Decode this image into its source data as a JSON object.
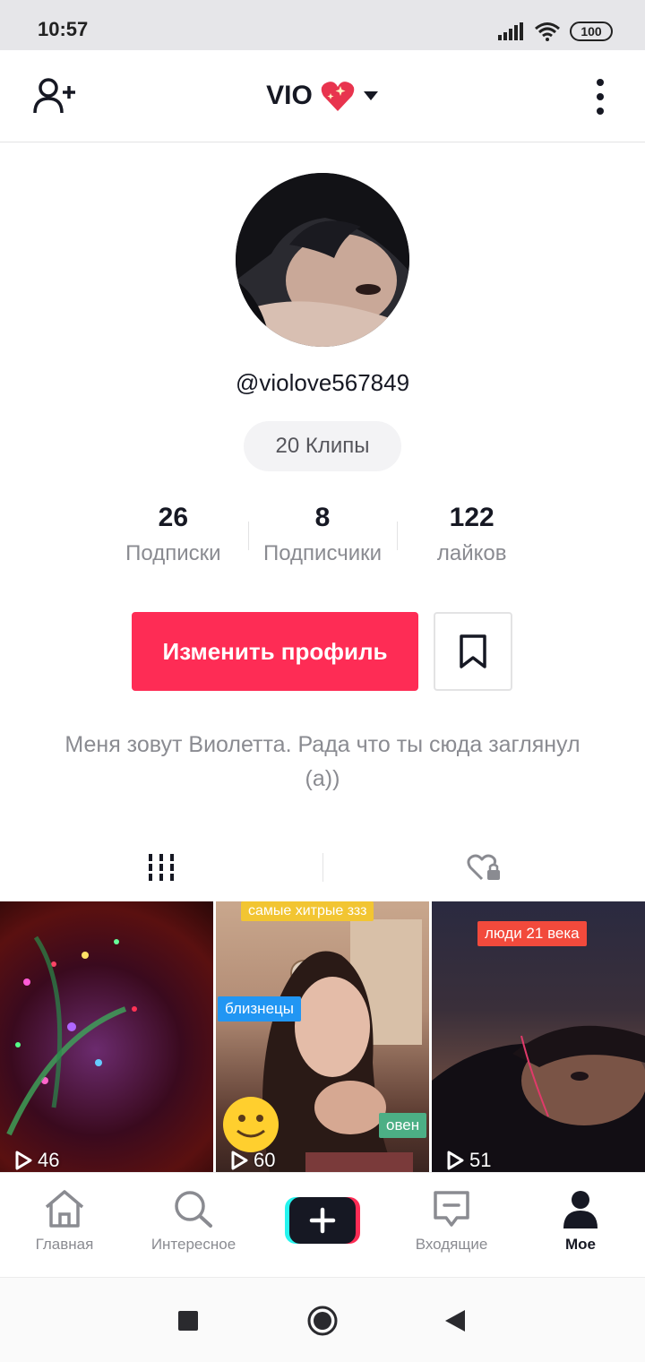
{
  "status_bar": {
    "time": "10:57",
    "battery": "100",
    "icons": [
      "signal-icon",
      "wifi-icon",
      "battery-icon"
    ]
  },
  "header": {
    "title": "VIO",
    "title_emoji": "💖",
    "left_icon": "add-friend-icon",
    "right_icon": "more-icon"
  },
  "profile": {
    "username": "@violove567849",
    "clips_label": "20 Клипы",
    "stats": [
      {
        "value": "26",
        "label": "Подписки"
      },
      {
        "value": "8",
        "label": "Подписчики"
      },
      {
        "value": "122",
        "label": "лайков"
      }
    ],
    "edit_button": "Изменить профиль",
    "bio": "Меня зовут Виолетта. Рада что ты сюда заглянул (а))"
  },
  "tabs": [
    {
      "icon": "grid-icon",
      "active": true
    },
    {
      "icon": "liked-private-icon",
      "active": false
    }
  ],
  "videos": [
    {
      "views": "46",
      "stickers": []
    },
    {
      "views": "60",
      "stickers": [
        "самые хитрые ззз",
        "близнецы",
        "овен"
      ]
    },
    {
      "views": "51",
      "stickers": [
        "люди 21 века"
      ]
    }
  ],
  "bottom_nav": [
    {
      "label": "Главная",
      "icon": "home-icon",
      "active": false
    },
    {
      "label": "Интересное",
      "icon": "search-icon",
      "active": false
    },
    {
      "label": "",
      "icon": "create-icon",
      "active": false
    },
    {
      "label": "Входящие",
      "icon": "inbox-icon",
      "active": false
    },
    {
      "label": "Мое",
      "icon": "profile-icon",
      "active": true
    }
  ],
  "colors": {
    "accent": "#fe2c55",
    "text_primary": "#161823",
    "text_secondary": "#8a8b91"
  }
}
